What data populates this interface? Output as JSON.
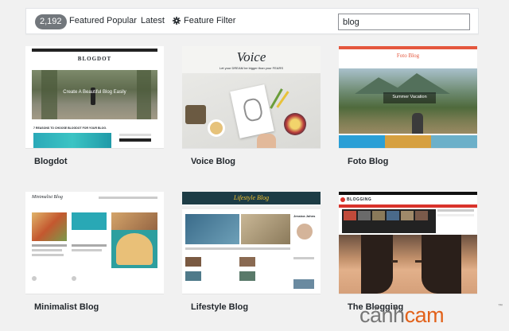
{
  "filterbar": {
    "count": "2,192",
    "links": [
      "Featured",
      "Popular",
      "Latest"
    ],
    "feature_filter": "Feature Filter",
    "search_value": "blog"
  },
  "themes": [
    {
      "name": "Blogdot",
      "preview": {
        "logo": "BLOGDOT",
        "hero_text": "Create A Beautiful Blog Easily",
        "post_title": "7 REASONS TO CHOOSE BLOGDOT FOR YOUR BLOG."
      }
    },
    {
      "name": "Voice Blog",
      "preview": {
        "title": "Voice",
        "tagline": "Let your DREAM be bigger than your FEARS"
      }
    },
    {
      "name": "Foto Blog",
      "preview": {
        "logo": "Foto Blog",
        "hero_text": "Summer Vacation"
      }
    },
    {
      "name": "Minimalist Blog",
      "preview": {
        "logo": "Minimalist Blog"
      }
    },
    {
      "name": "Lifestyle Blog",
      "preview": {
        "logo": "Lifestyle Blog",
        "author": "Jessica Johns"
      }
    },
    {
      "name": "The Blogging",
      "preview": {
        "logo": "BLOGGING"
      }
    }
  ],
  "watermark": {
    "part1": "cảnh",
    "part2": "cam",
    "tm": "™"
  }
}
